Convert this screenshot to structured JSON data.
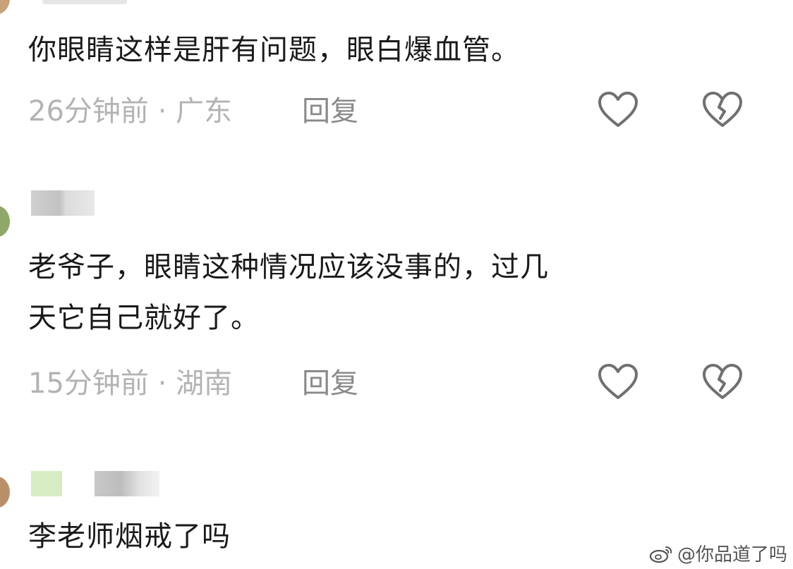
{
  "comments": [
    {
      "text_lines": [
        "你眼睛这样是肝有问题，眼白爆血管。"
      ],
      "time": "26分钟前",
      "separator": "·",
      "location": "广东",
      "reply_label": "回复"
    },
    {
      "text_lines": [
        "老爷子，眼睛这种情况应该没事的，过几",
        "天它自己就好了。"
      ],
      "time": "15分钟前",
      "separator": "·",
      "location": "湖南",
      "reply_label": "回复"
    },
    {
      "text_lines": [
        "李老师烟戒了吗"
      ]
    }
  ],
  "icons": {
    "like": "heart-outline-icon",
    "dislike": "broken-heart-icon",
    "watermark": "weibo-logo-icon"
  },
  "watermark": {
    "text": "@你品道了吗"
  },
  "colors": {
    "text": "#1a1a1a",
    "meta": "#b3b3b3",
    "reply": "#8a8a8a",
    "icon": "#707070"
  }
}
